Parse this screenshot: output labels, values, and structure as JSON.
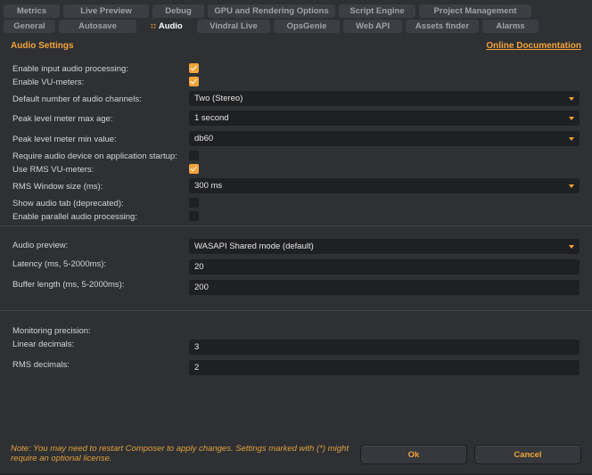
{
  "tabs_row1": [
    {
      "label": "Metrics",
      "w": 63
    },
    {
      "label": "Live Preview",
      "w": 96
    },
    {
      "label": "Debug",
      "w": 58
    },
    {
      "label": "GPU and Rendering Options",
      "w": 143
    },
    {
      "label": "Script Engine",
      "w": 86
    },
    {
      "label": "Project Management",
      "w": 126
    }
  ],
  "tabs_row2": [
    {
      "label": "General",
      "w": 58
    },
    {
      "label": "Autosave",
      "w": 87
    },
    {
      "label": "Audio",
      "w": 60,
      "active": true
    },
    {
      "label": "Vindral Live",
      "w": 82
    },
    {
      "label": "OpsGenie",
      "w": 74
    },
    {
      "label": "Web API",
      "w": 66
    },
    {
      "label": "Assets finder",
      "w": 82
    },
    {
      "label": "Alarms",
      "w": 63
    }
  ],
  "settings": {
    "section_title": "Audio Settings",
    "doc_link": "Online Documentation",
    "enable_input_audio_processing": {
      "label": "Enable input audio processing:",
      "checked": true
    },
    "enable_vu_meters": {
      "label": "Enable VU-meters:",
      "checked": true
    },
    "default_channels": {
      "label": "Default number of audio channels:",
      "value": "Two (Stereo)"
    },
    "peak_max_age": {
      "label": "Peak level meter max age:",
      "value": "1 second"
    },
    "peak_min_value": {
      "label": "Peak level meter min value:",
      "value": "db60"
    },
    "require_device": {
      "label": "Require audio device on application startup:",
      "checked": false
    },
    "use_rms": {
      "label": "Use RMS VU-meters:",
      "checked": true
    },
    "rms_window": {
      "label": "RMS Window size (ms):",
      "value": "300 ms"
    },
    "show_audio_tab": {
      "label": "Show audio tab (deprecated):",
      "checked": false
    },
    "parallel_processing": {
      "label": "Enable parallel audio processing:",
      "checked": false
    }
  },
  "preview": {
    "audio_preview": {
      "label": "Audio preview:",
      "value": "WASAPI Shared mode (default)"
    },
    "latency": {
      "label": "Latency (ms, 5-2000ms):",
      "value": "20"
    },
    "buffer_length": {
      "label": "Buffer length (ms, 5-2000ms):",
      "value": "200"
    }
  },
  "monitoring": {
    "heading": "Monitoring precision:",
    "linear": {
      "label": "Linear decimals:",
      "value": "3"
    },
    "rms": {
      "label": "RMS decimals:",
      "value": "2"
    }
  },
  "footer": {
    "note": "Note: You may need to restart Composer to apply changes. Settings marked with (*) might require an optional license.",
    "ok_label": "Ok",
    "cancel_label": "Cancel"
  },
  "colors": {
    "accent": "#f2a33a",
    "background": "#2e3033",
    "field": "#1f2022"
  }
}
